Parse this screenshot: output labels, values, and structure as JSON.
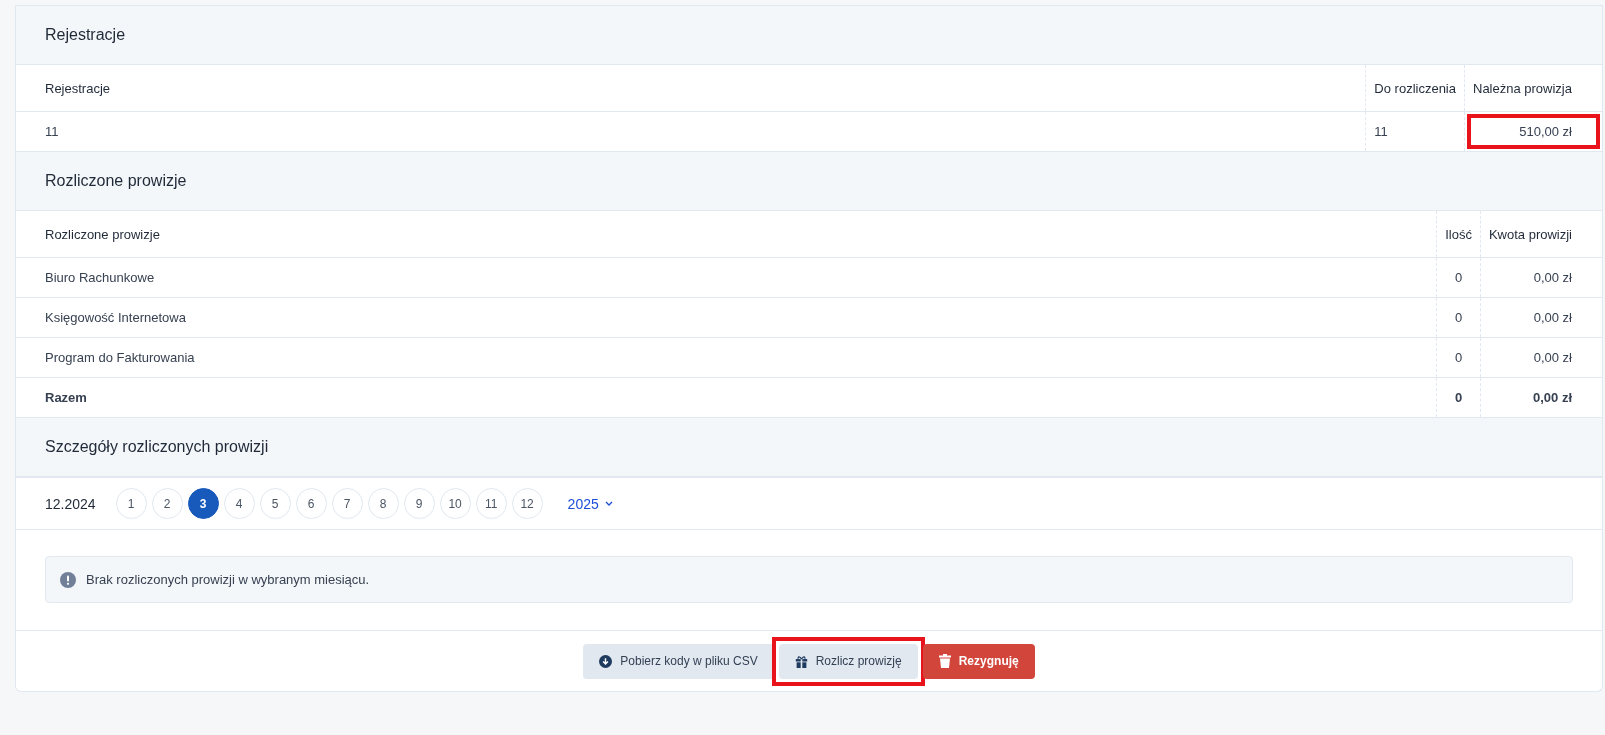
{
  "sections": [
    {
      "kind": "table",
      "title": "Rejestracje",
      "columns": [
        {
          "label": "Rejestracje",
          "kind": "text"
        },
        {
          "label": "Do rozliczenia",
          "kind": "text"
        },
        {
          "label": "Należna prowizja",
          "kind": "amount"
        }
      ],
      "rows": [
        {
          "total": false,
          "cells": [
            {
              "text": "11",
              "highlighted": false
            },
            {
              "text": "11",
              "highlighted": false
            },
            {
              "text": "510,00 zł",
              "highlighted": true
            }
          ]
        }
      ]
    },
    {
      "kind": "table",
      "title": "Rozliczone prowizje",
      "columns": [
        {
          "label": "Rozliczone prowizje",
          "kind": "text"
        },
        {
          "label": "Ilość",
          "kind": "count"
        },
        {
          "label": "Kwota prowizji",
          "kind": "amount"
        }
      ],
      "rows": [
        {
          "total": false,
          "cells": [
            {
              "text": "Biuro Rachunkowe",
              "highlighted": false
            },
            {
              "text": "0",
              "highlighted": false
            },
            {
              "text": "0,00 zł",
              "highlighted": false
            }
          ]
        },
        {
          "total": false,
          "cells": [
            {
              "text": "Księgowość Internetowa",
              "highlighted": false
            },
            {
              "text": "0",
              "highlighted": false
            },
            {
              "text": "0,00 zł",
              "highlighted": false
            }
          ]
        },
        {
          "total": false,
          "cells": [
            {
              "text": "Program do Fakturowania",
              "highlighted": false
            },
            {
              "text": "0",
              "highlighted": false
            },
            {
              "text": "0,00 zł",
              "highlighted": false
            }
          ]
        },
        {
          "total": true,
          "cells": [
            {
              "text": "Razem",
              "highlighted": false
            },
            {
              "text": "0",
              "highlighted": false
            },
            {
              "text": "0,00 zł",
              "highlighted": false
            }
          ]
        }
      ]
    },
    {
      "kind": "details",
      "title": "Szczegóły rozliczonych prowizji",
      "period": "12.2024",
      "months": [
        {
          "label": "1",
          "selected": false
        },
        {
          "label": "2",
          "selected": false
        },
        {
          "label": "3",
          "selected": true
        },
        {
          "label": "4",
          "selected": false
        },
        {
          "label": "5",
          "selected": false
        },
        {
          "label": "6",
          "selected": false
        },
        {
          "label": "7",
          "selected": false
        },
        {
          "label": "8",
          "selected": false
        },
        {
          "label": "9",
          "selected": false
        },
        {
          "label": "10",
          "selected": false
        },
        {
          "label": "11",
          "selected": false
        },
        {
          "label": "12",
          "selected": false
        }
      ],
      "year": "2025",
      "alert": "Brak rozliczonych prowizji w wybranym miesiącu."
    }
  ],
  "buttons": [
    {
      "label": "Pobierz kody w pliku CSV",
      "kind": "download",
      "highlighted": false
    },
    {
      "label": "Rozlicz prowizję",
      "kind": "gift",
      "highlighted": true
    },
    {
      "label": "Rezygnuję",
      "kind": "delete",
      "highlighted": false
    }
  ]
}
